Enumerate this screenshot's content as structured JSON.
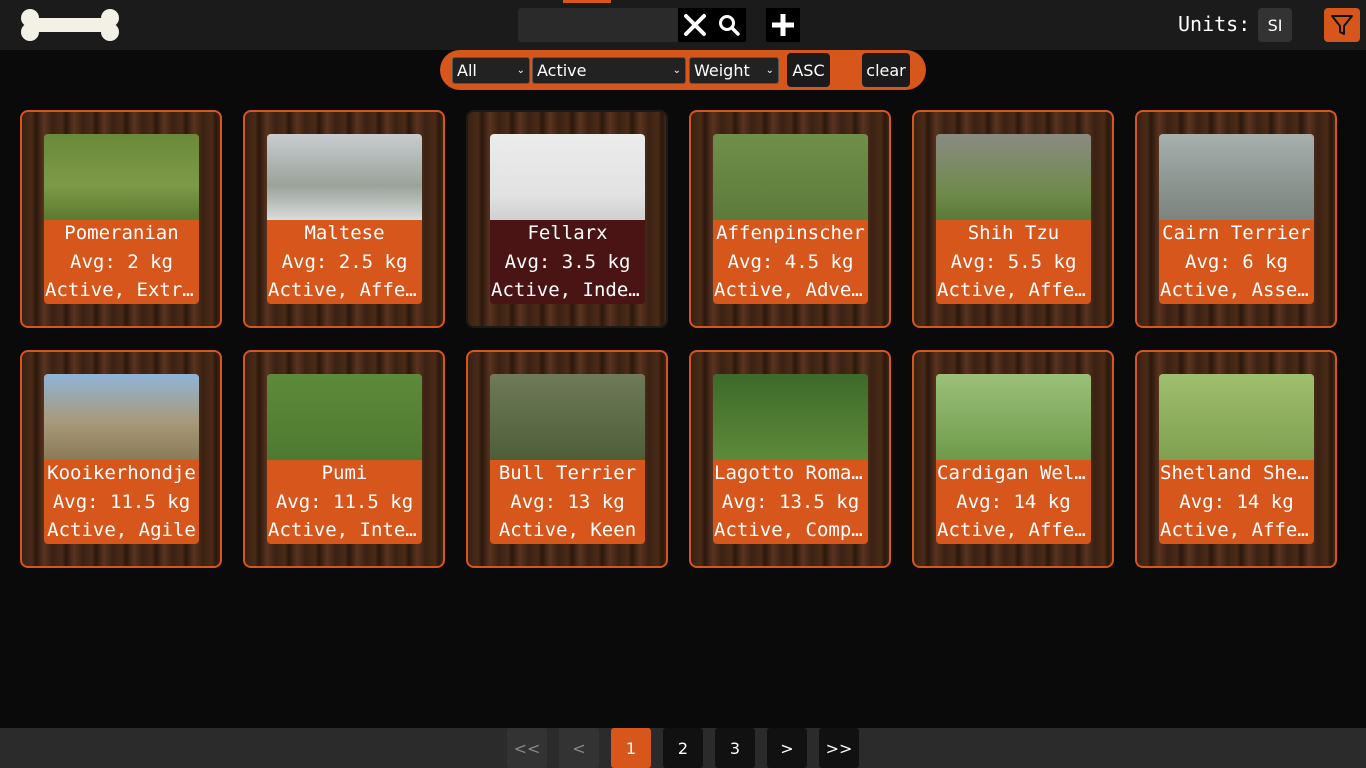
{
  "header": {
    "search_value": "",
    "search_placeholder": "",
    "units_label": "Units:",
    "units_value": "SI"
  },
  "filters": {
    "group": "All",
    "temperament": "Active",
    "sort_by": "Weight",
    "order": "ASC",
    "clear": "clear"
  },
  "breeds": [
    {
      "name": "Pomeranian",
      "avg": "Avg: 2 kg",
      "temperament": "Active, Extroverted",
      "selected": false
    },
    {
      "name": "Maltese",
      "avg": "Avg: 2.5 kg",
      "temperament": "Active, Affectionate",
      "selected": false
    },
    {
      "name": "Fellarx",
      "avg": "Avg: 3.5 kg",
      "temperament": "Active, Independent",
      "selected": true
    },
    {
      "name": "Affenpinscher",
      "avg": "Avg: 4.5 kg",
      "temperament": "Active, Adventurous",
      "selected": false
    },
    {
      "name": "Shih Tzu",
      "avg": "Avg: 5.5 kg",
      "temperament": "Active, Affectionate",
      "selected": false
    },
    {
      "name": "Cairn Terrier",
      "avg": "Avg: 6 kg",
      "temperament": "Active, Assertive",
      "selected": false
    },
    {
      "name": "Kooikerhondje",
      "avg": "Avg: 11.5 kg",
      "temperament": "Active, Agile",
      "selected": false
    },
    {
      "name": "Pumi",
      "avg": "Avg: 11.5 kg",
      "temperament": "Active, Intelligent",
      "selected": false
    },
    {
      "name": "Bull Terrier",
      "avg": "Avg: 13 kg",
      "temperament": "Active, Keen",
      "selected": false
    },
    {
      "name": "Lagotto Romagnolo",
      "avg": "Avg: 13.5 kg",
      "temperament": "Active, Companionable",
      "selected": false
    },
    {
      "name": "Cardigan Welsh Corgi",
      "avg": "Avg: 14 kg",
      "temperament": "Active, Affectionate",
      "selected": false
    },
    {
      "name": "Shetland Sheepdog",
      "avg": "Avg: 14 kg",
      "temperament": "Active, Affectionate",
      "selected": false
    }
  ],
  "pagination": {
    "first": "<<",
    "prev": "<",
    "pages": [
      "1",
      "2",
      "3"
    ],
    "current": "1",
    "next": ">",
    "last": ">>"
  },
  "colors": {
    "accent": "#d7561c",
    "topbar": "#1b1b1b",
    "background": "#0a0a0a",
    "selected_card": "#4a1414"
  }
}
